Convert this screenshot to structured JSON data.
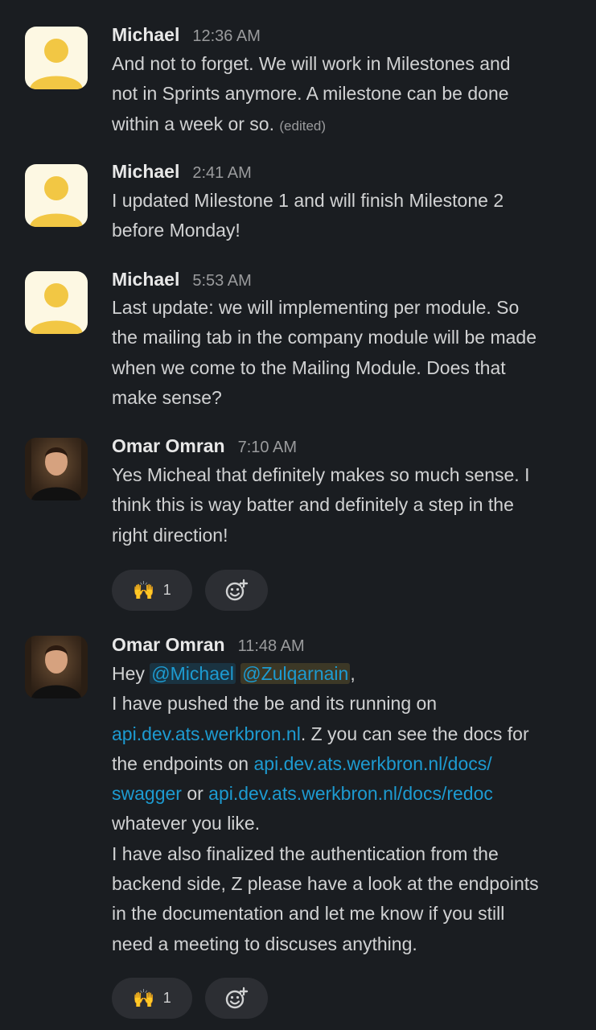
{
  "messages": [
    {
      "author": "Michael",
      "time": "12:36 AM",
      "lines": [
        "And not to forget. We will work in Milestones and",
        "not in Sprints anymore. A milestone can be done",
        "within a week or so."
      ],
      "edited": "(edited)"
    },
    {
      "author": "Michael",
      "time": "2:41 AM",
      "lines": [
        "I updated Milestone 1 and will finish Milestone 2",
        "before Monday!"
      ]
    },
    {
      "author": "Michael",
      "time": "5:53 AM",
      "lines": [
        "Last update: we will implementing per module. So",
        "the mailing tab in the company module will be made",
        "when we come to the Mailing Module. Does that",
        "make sense?"
      ]
    },
    {
      "author": "Omar Omran",
      "time": "7:10 AM",
      "lines": [
        "Yes Micheal that definitely makes so much sense. I",
        "think this is way batter and definitely a step in the",
        "right direction!"
      ],
      "reaction": {
        "emoji": "🙌",
        "icon": "raising-hands-icon",
        "count": "1"
      }
    },
    {
      "author": "Omar Omran",
      "time": "11:48 AM",
      "greeting": "Hey",
      "mention1": "@Michael",
      "mention2": "@Zulqarnain",
      "comma": ",",
      "line2": "I have pushed the be and its running on",
      "link1": "api.dev.ats.werkbron.nl",
      "line3_rest": ". Z you can see the docs for",
      "line4_pre": "the endpoints on ",
      "link2a": "api.dev.ats.werkbron.nl/docs/",
      "link2b": "swagger",
      "or": " or ",
      "link3": "api.dev.ats.werkbron.nl/docs/redoc",
      "lines_after": [
        "whatever you like.",
        "I have also finalized the authentication from the",
        "backend side, Z please have a look at the endpoints",
        "in the documentation and let me know if you still",
        "need a meeting to discuses anything."
      ],
      "reaction": {
        "emoji": "🙌",
        "icon": "raising-hands-icon",
        "count": "1"
      }
    }
  ],
  "icons": {
    "add_reaction": "add-reaction-smiley-icon",
    "default_avatar": "default-user-avatar-icon"
  },
  "colors": {
    "background": "#1a1d21",
    "link": "#1d9bd1",
    "avatar_default": "#f2c744",
    "avatar_default_bg": "#fdf8e3",
    "pill": "#2c2e33"
  }
}
